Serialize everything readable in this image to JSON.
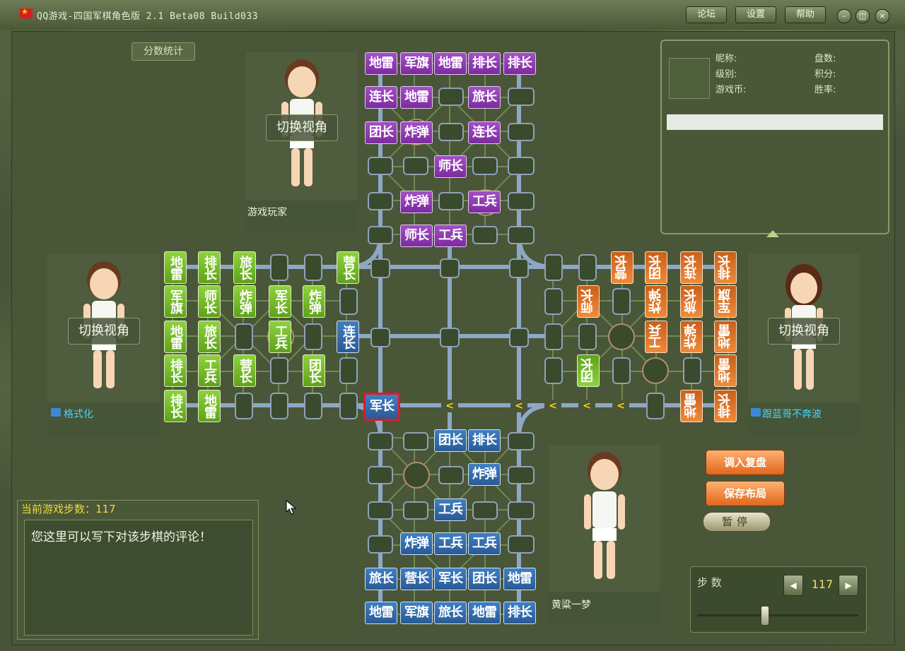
{
  "window": {
    "title": "QQ游戏-四国军棋角色版 2.1 Beta08 Build033",
    "buttons": [
      "论坛",
      "设置",
      "帮助"
    ]
  },
  "score_tab": "分数统计",
  "players": {
    "top": {
      "name": "游戏玩家",
      "switch_label": "切换视角"
    },
    "left": {
      "name": "格式化",
      "switch_label": "切换视角"
    },
    "right": {
      "name": "跟蓝哥不奔波",
      "switch_label": "切换视角"
    },
    "bottom": {
      "name": "黄粱一梦"
    }
  },
  "info": {
    "nickname_label": "昵称:",
    "rank_label": "级别:",
    "coins_label": "游戏币:",
    "games_label": "盘数:",
    "points_label": "积分:",
    "winrate_label": "胜率:"
  },
  "actions": {
    "load_replay": "调入复盘",
    "save_layout": "保存布局",
    "pause": "暂停"
  },
  "steps": {
    "label": "步 数",
    "value": "117"
  },
  "comment": {
    "header": "当前游戏步数：117",
    "placeholder": "您这里可以写下对该步棋的评论！"
  },
  "pieces": {
    "top": [
      "地雷",
      "军旗",
      "地雷",
      "排长",
      "排长",
      "连长",
      "地雷",
      "旅长",
      "团长",
      "炸弹",
      "连长",
      "师长",
      "炸弹",
      "工兵",
      "师长",
      "工兵"
    ],
    "left": [
      "地雷",
      "排长",
      "旅长",
      "营长",
      "军旗",
      "师长",
      "炸弹",
      "军长",
      "炸弹",
      "地雷",
      "旅长",
      "工兵",
      "排长",
      "工兵",
      "营长",
      "团长",
      "排长",
      "地雷"
    ],
    "right": [
      "营长",
      "团长",
      "连长",
      "排长",
      "师长",
      "炸弹",
      "旅长",
      "军旗",
      "工兵",
      "炸弹",
      "地雷",
      "团长",
      "地雷",
      "地雷",
      "排长"
    ],
    "bottom": [
      "团长",
      "排长",
      "炸弹",
      "工兵",
      "炸弹",
      "工兵",
      "工兵",
      "旅长",
      "营长",
      "军长",
      "团长",
      "地雷",
      "地雷",
      "军旗",
      "旅长",
      "地雷",
      "排长"
    ],
    "center": [
      "连长",
      "军长"
    ]
  },
  "colors": {
    "top": "#8a3cb0",
    "left": "#74b82c",
    "right": "#e0762a",
    "bottom": "#356fae",
    "highlight": "#e01a2a"
  }
}
